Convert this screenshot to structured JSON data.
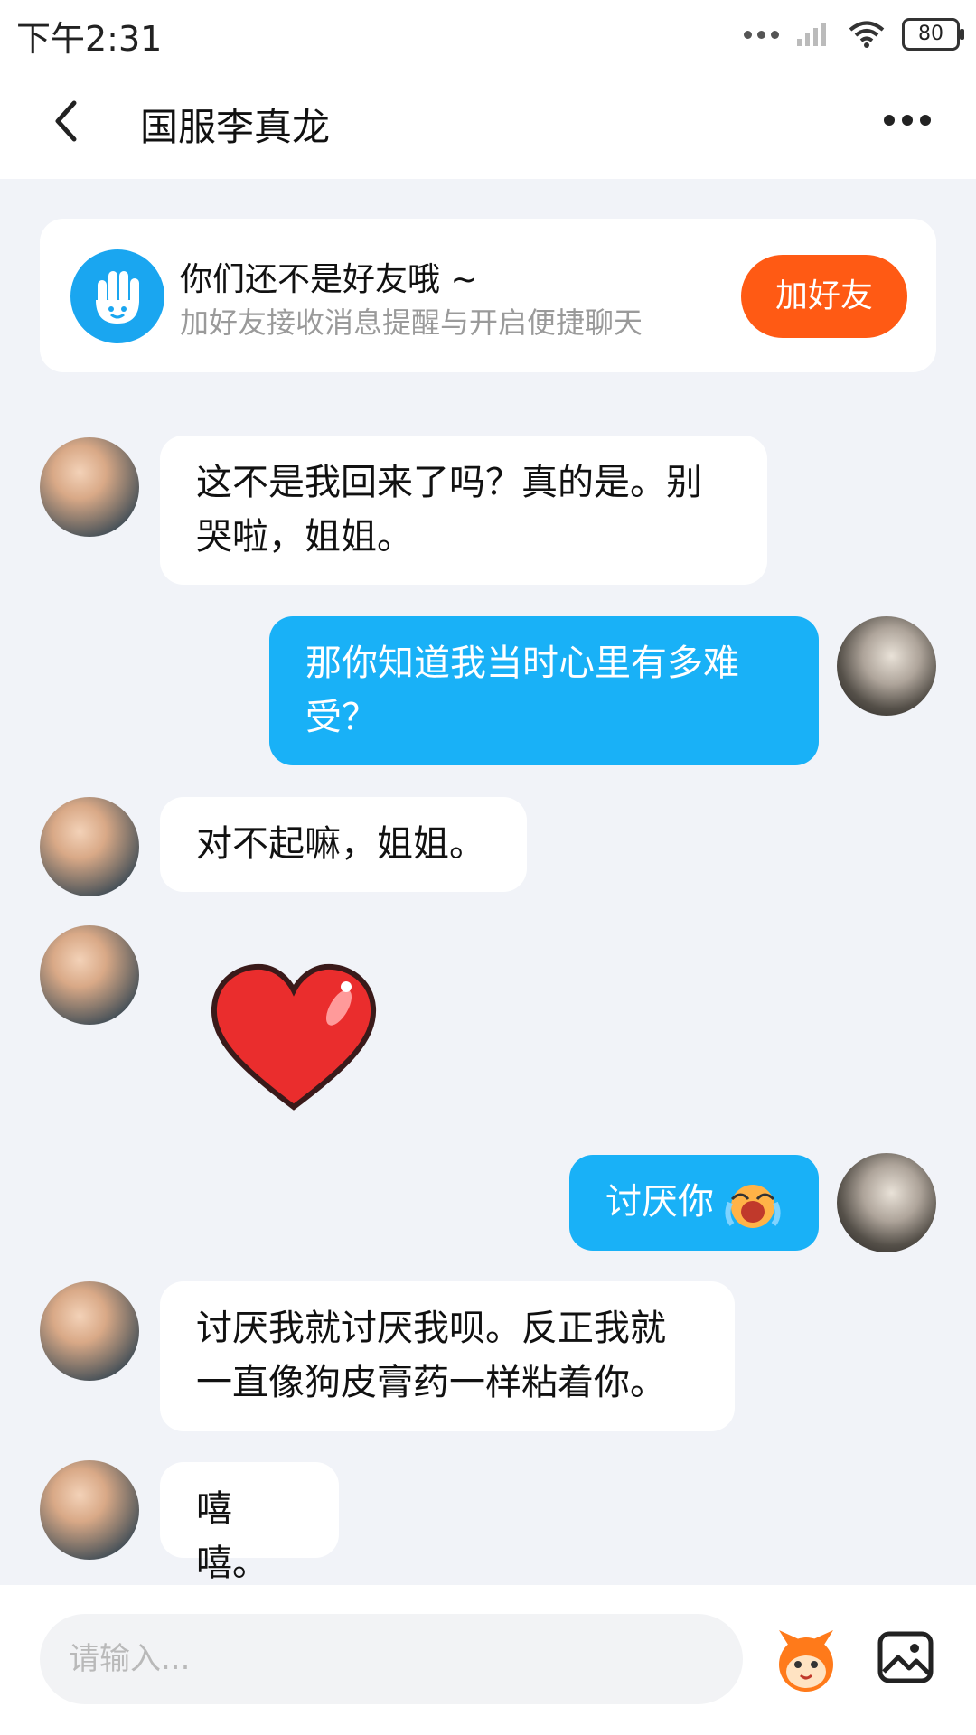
{
  "status_bar": {
    "time": "下午2:31",
    "battery": "80"
  },
  "nav": {
    "title": "国服李真龙"
  },
  "friend_card": {
    "title": "你们还不是好友哦 ~",
    "subtitle": "加好友接收消息提醒与开启便捷聊天",
    "add_button": "加好友"
  },
  "messages": [
    {
      "side": "in",
      "text": "这不是我回来了吗？真的是。别哭啦，姐姐。"
    },
    {
      "side": "out",
      "text": "那你知道我当时心里有多难受？"
    },
    {
      "side": "in",
      "text": "对不起嘛，姐姐。"
    },
    {
      "side": "in",
      "type": "sticker",
      "sticker": "heart-sticker"
    },
    {
      "side": "out",
      "text": "讨厌你"
    },
    {
      "side": "in",
      "text": "讨厌我就讨厌我呗。反正我就一直像狗皮膏药一样粘着你。"
    },
    {
      "side": "in",
      "text": "嘻嘻。"
    }
  ],
  "input": {
    "placeholder": "请输入..."
  },
  "icons": {
    "back": "chevron-left-icon",
    "more": "more-horizontal-icon",
    "hand": "hand-icon",
    "emoji": "emoji-face-icon",
    "image": "image-icon"
  },
  "colors": {
    "accent_orange": "#ff5a14",
    "bubble_blue": "#19b1f7",
    "page_bg": "#f1f3f8"
  }
}
